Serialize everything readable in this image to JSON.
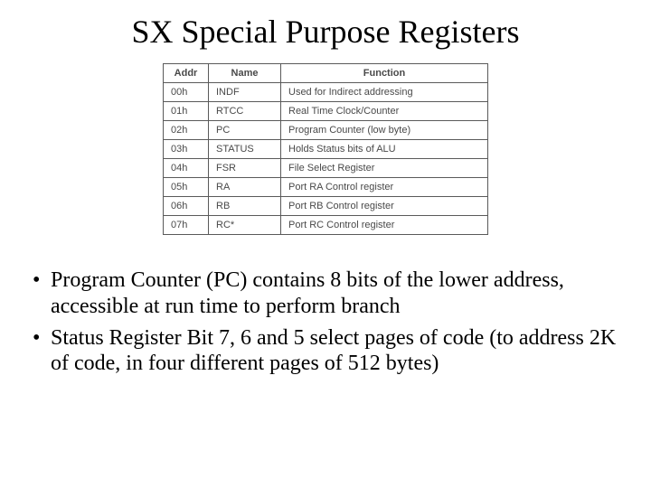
{
  "title": "SX Special Purpose Registers",
  "table": {
    "headers": [
      "Addr",
      "Name",
      "Function"
    ],
    "rows": [
      [
        "00h",
        "INDF",
        "Used for Indirect addressing"
      ],
      [
        "01h",
        "RTCC",
        "Real Time Clock/Counter"
      ],
      [
        "02h",
        "PC",
        "Program Counter (low byte)"
      ],
      [
        "03h",
        "STATUS",
        "Holds Status bits of ALU"
      ],
      [
        "04h",
        "FSR",
        "File Select Register"
      ],
      [
        "05h",
        "RA",
        "Port RA Control register"
      ],
      [
        "06h",
        "RB",
        "Port RB Control register"
      ],
      [
        "07h",
        "RC*",
        "Port RC Control register"
      ]
    ]
  },
  "bullets": [
    "Program Counter (PC) contains 8 bits of the lower address, accessible at run time to perform branch",
    "Status Register Bit 7, 6 and 5 select pages of code (to address 2K of code, in four different pages of 512 bytes)"
  ]
}
